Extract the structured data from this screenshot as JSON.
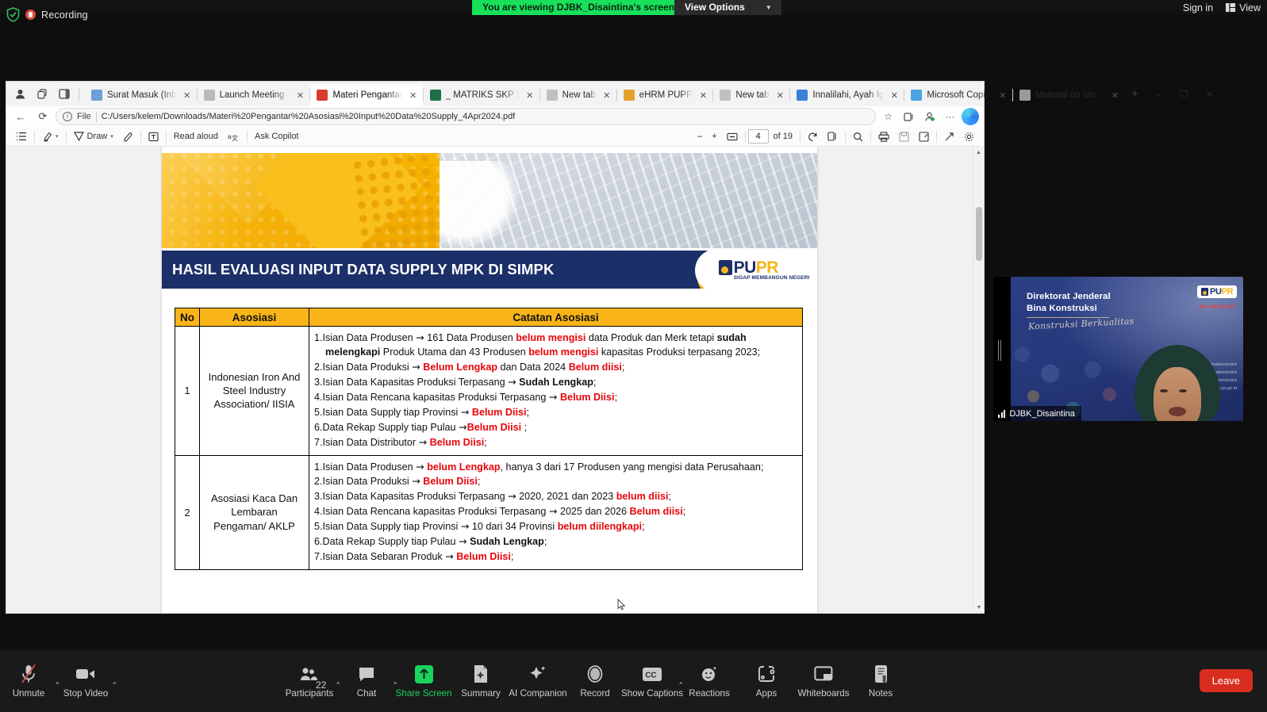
{
  "zoom_topbar": {
    "recording_label": "Recording",
    "viewing_banner": "You are viewing DJBK_Disaintina's screen",
    "view_options_label": "View Options",
    "view_options_caret": "chevron-down-icon",
    "sign_in_label": "Sign in",
    "view_label": "View"
  },
  "browser": {
    "tabs": [
      {
        "title": "Surat Masuk (Inb",
        "favicon": "mail-icon",
        "color": "#6f9fd8",
        "active": false
      },
      {
        "title": "Launch Meeting -",
        "favicon": "page-icon",
        "color": "#b9b9b9",
        "active": false
      },
      {
        "title": "Materi Pengantar",
        "favicon": "pdf-icon",
        "color": "#d83b2e",
        "active": true
      },
      {
        "title": "_ MATRIKS SKP 2",
        "favicon": "excel-icon",
        "color": "#1d7044",
        "active": false
      },
      {
        "title": "New tab",
        "favicon": "newtab-icon",
        "color": "#c0c0c0",
        "active": false
      },
      {
        "title": "eHRM PUPR",
        "favicon": "pupr-icon",
        "color": "#e6a12a",
        "active": false
      },
      {
        "title": "New tab",
        "favicon": "newtab-icon",
        "color": "#c0c0c0",
        "active": false
      },
      {
        "title": "Innalilahi, Ayah Ig",
        "favicon": "ms-icon",
        "color": "#3a7fd5",
        "active": false
      },
      {
        "title": "Microsoft Copilo",
        "favicon": "copilot-icon",
        "color": "#4aa3e0",
        "active": false
      },
      {
        "title": "Material on site d",
        "favicon": "search-icon",
        "color": "#9a9a9a",
        "active": false
      }
    ],
    "tab_close_glyph": "✕",
    "new_tab_glyph": "+",
    "window_minimize": "–",
    "window_restore": "❐",
    "window_close": "✕",
    "address": {
      "back_glyph": "←",
      "reload_glyph": "⟳",
      "info_glyph": "i",
      "scheme_label": "File",
      "url": "C:/Users/kelem/Downloads/Materi%20Pengantar%20Asosiasi%20Input%20Data%20Supply_4Apr2024.pdf",
      "favorite_icon": "star-icon",
      "collections_icon": "collections-icon",
      "profile_icon": "profile-icon",
      "more_icon": "ellipsis-icon",
      "copilot_icon": "copilot-icon"
    }
  },
  "pdf_toolbar": {
    "left_items": [
      {
        "name": "toc-icon",
        "label": ""
      },
      {
        "name": "highlight-icon",
        "label": "",
        "caret": true
      },
      {
        "name": "draw-icon",
        "label": "Draw",
        "caret": true
      },
      {
        "name": "erase-icon",
        "label": ""
      },
      {
        "name": "text-icon",
        "label": ""
      },
      {
        "name": "read-aloud",
        "label": "Read aloud"
      },
      {
        "name": "translate-icon",
        "label": ""
      },
      {
        "name": "ask-copilot",
        "label": "Ask Copilot"
      }
    ],
    "zoom_out_glyph": "–",
    "zoom_in_glyph": "+",
    "fit_page_icon": "fit-page-icon",
    "current_page": "4",
    "page_total_label": "of 19",
    "rotate_icon": "rotate-icon",
    "layout_icon": "page-layout-icon",
    "right_items": [
      {
        "name": "search-icon"
      },
      {
        "name": "print-icon"
      },
      {
        "name": "save-icon"
      },
      {
        "name": "save-as-icon"
      },
      {
        "name": "fullscreen-icon"
      },
      {
        "name": "settings-icon"
      }
    ]
  },
  "slide": {
    "title": "HASIL EVALUASI INPUT DATA SUPPLY MPK DI SIMPK",
    "logo": {
      "pu": "PU",
      "pr": "PR",
      "tagline": "SIGAP MEMBANGUN NEGERI"
    },
    "table": {
      "headers": [
        "No",
        "Asosiasi",
        "Catatan Asosiasi"
      ],
      "rows": [
        {
          "no": "1",
          "asosiasi": "Indonesian Iron And Steel Industry Association/ IISIA",
          "notes": [
            "1.Isian Data Produsen  → 161 Data Produsen belum mengisi data Produk dan Merk tetapi sudah melengkapi Produk Utama dan 43 Produsen belum mengisi kapasitas Produksi terpasang 2023;",
            "2.Isian Data Produksi  → Belum Lengkap dan Data 2024 Belum diisi;",
            "3.Isian Data Kapasitas Produksi Terpasang  → Sudah Lengkap;",
            "4.Isian Data Rencana kapasitas Produksi Terpasang  → Belum Diisi;",
            "5.Isian Data Supply tiap Provinsi  → Belum Diisi;",
            "6.Data Rekap Supply tiap Pulau  →Belum Diisi ;",
            "7.Isian Data Distributor  →  Belum Diisi;"
          ]
        },
        {
          "no": "2",
          "asosiasi": "Asosiasi Kaca Dan Lembaran Pengaman/ AKLP",
          "notes": [
            "1.Isian Data Produsen   →   belum Lengkap, hanya 3 dari 17 Produsen yang mengisi data Perusahaan;",
            "2.Isian Data Produksi  → Belum Diisi;",
            "3.Isian Data Kapasitas Produksi Terpasang  → 2020, 2021 dan 2023 belum diisi;",
            "4.Isian Data Rencana kapasitas Produksi Terpasang  → 2025 dan 2026 Belum diisi;",
            "5.Isian Data Supply tiap Provinsi  → 10 dari 34 Provinsi belum diilengkapi;",
            "6.Data Rekap Supply tiap Pulau  → Sudah Lengkap;",
            "7.Isian Data Sebaran Produk  → Belum Diisi;"
          ]
        }
      ]
    }
  },
  "video_panel": {
    "org_line1": "Direktorat Jenderal",
    "org_line2": "Bina Konstruksi",
    "tagline_script": "Konstruksi Berkualitas",
    "berakhlak": "BerAKHLAK",
    "logo": {
      "pu": "PU",
      "pr": "PR"
    },
    "handles": [
      "pupr_binakonstruksi",
      "pupr_binakonstruksi",
      "puprbinakonstruksi",
      "binakonstruksi.pu.go.id"
    ],
    "participant_name": "DJBK_Disaintina",
    "signal_icon": "signal-bars-icon"
  },
  "zoom_bottom": {
    "items": [
      {
        "label": "Unmute",
        "icon": "mic-muted-icon",
        "caret": true,
        "green": false
      },
      {
        "label": "Stop Video",
        "icon": "video-camera-icon",
        "caret": true,
        "green": false
      },
      {
        "label": "Participants",
        "icon": "participants-icon",
        "caret": true,
        "green": false,
        "badge": "22"
      },
      {
        "label": "Chat",
        "icon": "chat-bubble-icon",
        "caret": true,
        "green": false
      },
      {
        "label": "Share Screen",
        "icon": "share-screen-icon",
        "caret": false,
        "green": true
      },
      {
        "label": "Summary",
        "icon": "summary-icon",
        "caret": false,
        "green": false
      },
      {
        "label": "AI Companion",
        "icon": "ai-sparkle-icon",
        "caret": false,
        "green": false
      },
      {
        "label": "Record",
        "icon": "record-circle-icon",
        "caret": false,
        "green": false
      },
      {
        "label": "Show Captions",
        "icon": "cc-icon",
        "caret": true,
        "green": false
      },
      {
        "label": "Reactions",
        "icon": "reactions-icon",
        "caret": false,
        "green": false
      },
      {
        "label": "Apps",
        "icon": "apps-icon",
        "caret": false,
        "green": false
      },
      {
        "label": "Whiteboards",
        "icon": "whiteboard-icon",
        "caret": false,
        "green": false
      },
      {
        "label": "Notes",
        "icon": "notes-icon",
        "caret": false,
        "green": false
      }
    ],
    "leave_label": "Leave"
  },
  "colors": {
    "zoom_green": "#18e05a",
    "leave_red": "#d92d20",
    "slide_navy": "#1b3069",
    "slide_amber": "#f9b518",
    "note_red": "#e8050a"
  }
}
